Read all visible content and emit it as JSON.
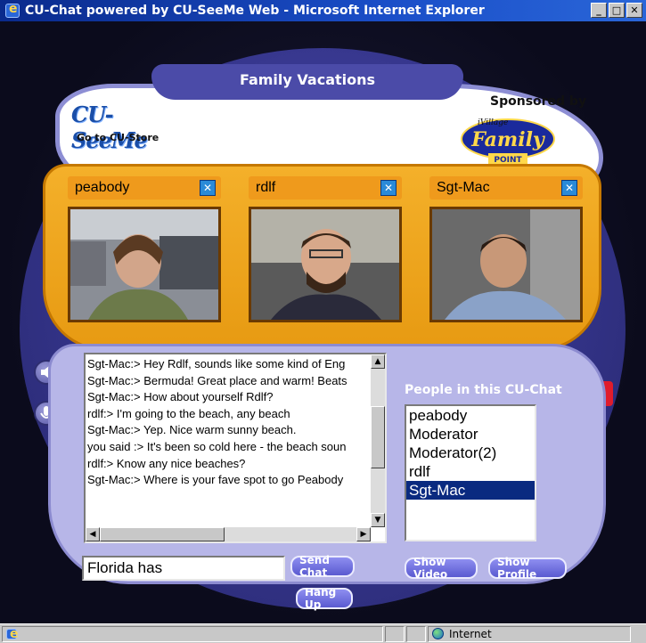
{
  "window": {
    "title": "CU-Chat powered by CU-SeeMe Web - Microsoft Internet Explorer",
    "buttons": [
      "minimize",
      "maximize",
      "close"
    ]
  },
  "header": {
    "room_title": "Family Vacations",
    "logo_text": "CU-SeeMe",
    "store_link": "Go to CU-Store",
    "sponsor_label": "Sponsored by",
    "sponsor_logo_small": "iVillage",
    "sponsor_logo_main": "Family",
    "sponsor_logo_sub": "POINT"
  },
  "videos": [
    {
      "name": "peabody",
      "close_icon": "close-x-icon"
    },
    {
      "name": "rdlf",
      "close_icon": "close-x-icon"
    },
    {
      "name": "Sgt-Mac",
      "close_icon": "close-x-icon"
    }
  ],
  "chat": {
    "lines": [
      "Sgt-Mac:> Hey Rdlf, sounds like some kind of Eng",
      "Sgt-Mac:> Bermuda! Great place and warm! Beats",
      "Sgt-Mac:> How about yourself Rdlf?",
      "rdlf:> I'm going to the beach, any beach",
      "Sgt-Mac:> Yep. Nice warm sunny beach.",
      "you said :> It's been so cold here - the beach soun",
      "rdlf:> Know any nice beaches?",
      "Sgt-Mac:> Where is your fave spot to go Peabody"
    ],
    "input_value": "Florida has",
    "send_label": "Send Chat",
    "hangup_label": "Hang Up"
  },
  "people": {
    "title": "People in this CU-Chat",
    "list": [
      "peabody",
      "Moderator",
      "Moderator(2)",
      "rdlf",
      "Sgt-Mac"
    ],
    "selected": "Sgt-Mac",
    "show_video_label": "Show Video",
    "show_profile_label": "Show Profile"
  },
  "side_icons": [
    "speaker-icon",
    "microphone-icon",
    "alert-icon"
  ],
  "status": {
    "zone": "Internet"
  },
  "colors": {
    "video_frame": "#f4b02a",
    "console": "#b7b6e8",
    "stage_oval": "#34348a",
    "selection": "#0a2a80",
    "button_blue": "#5a5ad0"
  }
}
